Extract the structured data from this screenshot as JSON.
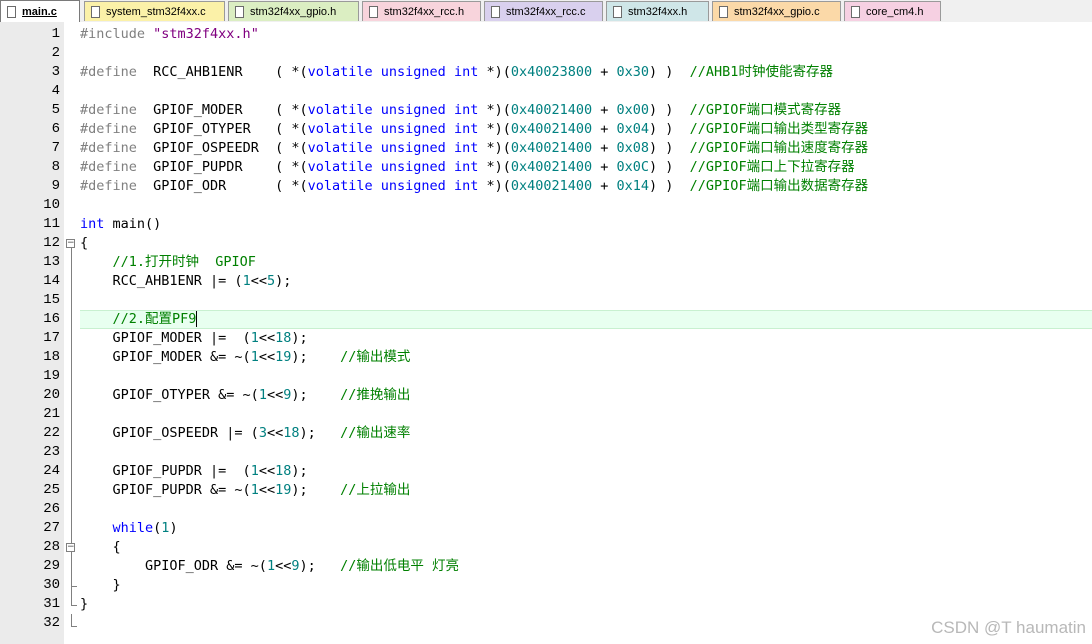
{
  "tabs": [
    {
      "label": "main.c",
      "color": "#ffffff",
      "active": true
    },
    {
      "label": "system_stm32f4xx.c",
      "color": "#fbf1a8",
      "active": false
    },
    {
      "label": "stm32f4xx_gpio.h",
      "color": "#dbeec2",
      "active": false
    },
    {
      "label": "stm32f4xx_rcc.h",
      "color": "#f8d4dc",
      "active": false
    },
    {
      "label": "stm32f4xx_rcc.c",
      "color": "#d9d0ee",
      "active": false
    },
    {
      "label": "stm32f4xx.h",
      "color": "#cfe6e8",
      "active": false
    },
    {
      "label": "stm32f4xx_gpio.c",
      "color": "#fbd9a8",
      "active": false
    },
    {
      "label": "core_cm4.h",
      "color": "#f6d0e2",
      "active": false
    }
  ],
  "editor": {
    "current_line": 16,
    "fold_markers": [
      12,
      28
    ],
    "lines": [
      {
        "n": "1",
        "tokens": [
          [
            "pp",
            "#include "
          ],
          [
            "str",
            "\"stm32f4xx.h\""
          ]
        ]
      },
      {
        "n": "2",
        "tokens": []
      },
      {
        "n": "3",
        "tokens": [
          [
            "pp",
            "#define"
          ],
          [
            "plain",
            "  RCC_AHB1ENR    ( *("
          ],
          [
            "kw",
            "volatile"
          ],
          [
            "plain",
            " "
          ],
          [
            "kw",
            "unsigned"
          ],
          [
            "plain",
            " "
          ],
          [
            "kw",
            "int"
          ],
          [
            "plain",
            " *)("
          ],
          [
            "num",
            "0x40023800"
          ],
          [
            "plain",
            " + "
          ],
          [
            "num",
            "0x30"
          ],
          [
            "plain",
            ") )  "
          ],
          [
            "cmt",
            "//AHB1时钟使能寄存器"
          ]
        ]
      },
      {
        "n": "4",
        "tokens": []
      },
      {
        "n": "5",
        "tokens": [
          [
            "pp",
            "#define"
          ],
          [
            "plain",
            "  GPIOF_MODER    ( *("
          ],
          [
            "kw",
            "volatile"
          ],
          [
            "plain",
            " "
          ],
          [
            "kw",
            "unsigned"
          ],
          [
            "plain",
            " "
          ],
          [
            "kw",
            "int"
          ],
          [
            "plain",
            " *)("
          ],
          [
            "num",
            "0x40021400"
          ],
          [
            "plain",
            " + "
          ],
          [
            "num",
            "0x00"
          ],
          [
            "plain",
            ") )  "
          ],
          [
            "cmt",
            "//GPIOF端口模式寄存器"
          ]
        ]
      },
      {
        "n": "6",
        "tokens": [
          [
            "pp",
            "#define"
          ],
          [
            "plain",
            "  GPIOF_OTYPER   ( *("
          ],
          [
            "kw",
            "volatile"
          ],
          [
            "plain",
            " "
          ],
          [
            "kw",
            "unsigned"
          ],
          [
            "plain",
            " "
          ],
          [
            "kw",
            "int"
          ],
          [
            "plain",
            " *)("
          ],
          [
            "num",
            "0x40021400"
          ],
          [
            "plain",
            " + "
          ],
          [
            "num",
            "0x04"
          ],
          [
            "plain",
            ") )  "
          ],
          [
            "cmt",
            "//GPIOF端口输出类型寄存器"
          ]
        ]
      },
      {
        "n": "7",
        "tokens": [
          [
            "pp",
            "#define"
          ],
          [
            "plain",
            "  GPIOF_OSPEEDR  ( *("
          ],
          [
            "kw",
            "volatile"
          ],
          [
            "plain",
            " "
          ],
          [
            "kw",
            "unsigned"
          ],
          [
            "plain",
            " "
          ],
          [
            "kw",
            "int"
          ],
          [
            "plain",
            " *)("
          ],
          [
            "num",
            "0x40021400"
          ],
          [
            "plain",
            " + "
          ],
          [
            "num",
            "0x08"
          ],
          [
            "plain",
            ") )  "
          ],
          [
            "cmt",
            "//GPIOF端口输出速度寄存器"
          ]
        ]
      },
      {
        "n": "8",
        "tokens": [
          [
            "pp",
            "#define"
          ],
          [
            "plain",
            "  GPIOF_PUPDR    ( *("
          ],
          [
            "kw",
            "volatile"
          ],
          [
            "plain",
            " "
          ],
          [
            "kw",
            "unsigned"
          ],
          [
            "plain",
            " "
          ],
          [
            "kw",
            "int"
          ],
          [
            "plain",
            " *)("
          ],
          [
            "num",
            "0x40021400"
          ],
          [
            "plain",
            " + "
          ],
          [
            "num",
            "0x0C"
          ],
          [
            "plain",
            ") )  "
          ],
          [
            "cmt",
            "//GPIOF端口上下拉寄存器"
          ]
        ]
      },
      {
        "n": "9",
        "tokens": [
          [
            "pp",
            "#define"
          ],
          [
            "plain",
            "  GPIOF_ODR      ( *("
          ],
          [
            "kw",
            "volatile"
          ],
          [
            "plain",
            " "
          ],
          [
            "kw",
            "unsigned"
          ],
          [
            "plain",
            " "
          ],
          [
            "kw",
            "int"
          ],
          [
            "plain",
            " *)("
          ],
          [
            "num",
            "0x40021400"
          ],
          [
            "plain",
            " + "
          ],
          [
            "num",
            "0x14"
          ],
          [
            "plain",
            ") )  "
          ],
          [
            "cmt",
            "//GPIOF端口输出数据寄存器"
          ]
        ]
      },
      {
        "n": "10",
        "tokens": []
      },
      {
        "n": "11",
        "tokens": [
          [
            "kw",
            "int"
          ],
          [
            "plain",
            " main()"
          ]
        ]
      },
      {
        "n": "12",
        "tokens": [
          [
            "plain",
            "{"
          ]
        ]
      },
      {
        "n": "13",
        "tokens": [
          [
            "plain",
            "    "
          ],
          [
            "cmt",
            "//1.打开时钟  GPIOF"
          ]
        ]
      },
      {
        "n": "14",
        "tokens": [
          [
            "plain",
            "    RCC_AHB1ENR |= ("
          ],
          [
            "num",
            "1"
          ],
          [
            "plain",
            "<<"
          ],
          [
            "num",
            "5"
          ],
          [
            "plain",
            ");"
          ]
        ]
      },
      {
        "n": "15",
        "tokens": []
      },
      {
        "n": "16",
        "tokens": [
          [
            "plain",
            "    "
          ],
          [
            "cmt",
            "//2.配置PF9"
          ]
        ]
      },
      {
        "n": "17",
        "tokens": [
          [
            "plain",
            "    GPIOF_MODER |=  ("
          ],
          [
            "num",
            "1"
          ],
          [
            "plain",
            "<<"
          ],
          [
            "num",
            "18"
          ],
          [
            "plain",
            ");"
          ]
        ]
      },
      {
        "n": "18",
        "tokens": [
          [
            "plain",
            "    GPIOF_MODER &= ~("
          ],
          [
            "num",
            "1"
          ],
          [
            "plain",
            "<<"
          ],
          [
            "num",
            "19"
          ],
          [
            "plain",
            ");    "
          ],
          [
            "cmt",
            "//输出模式"
          ]
        ]
      },
      {
        "n": "19",
        "tokens": []
      },
      {
        "n": "20",
        "tokens": [
          [
            "plain",
            "    GPIOF_OTYPER &= ~("
          ],
          [
            "num",
            "1"
          ],
          [
            "plain",
            "<<"
          ],
          [
            "num",
            "9"
          ],
          [
            "plain",
            ");    "
          ],
          [
            "cmt",
            "//推挽输出"
          ]
        ]
      },
      {
        "n": "21",
        "tokens": []
      },
      {
        "n": "22",
        "tokens": [
          [
            "plain",
            "    GPIOF_OSPEEDR |= ("
          ],
          [
            "num",
            "3"
          ],
          [
            "plain",
            "<<"
          ],
          [
            "num",
            "18"
          ],
          [
            "plain",
            ");   "
          ],
          [
            "cmt",
            "//输出速率"
          ]
        ]
      },
      {
        "n": "23",
        "tokens": []
      },
      {
        "n": "24",
        "tokens": [
          [
            "plain",
            "    GPIOF_PUPDR |=  ("
          ],
          [
            "num",
            "1"
          ],
          [
            "plain",
            "<<"
          ],
          [
            "num",
            "18"
          ],
          [
            "plain",
            ");"
          ]
        ]
      },
      {
        "n": "25",
        "tokens": [
          [
            "plain",
            "    GPIOF_PUPDR &= ~("
          ],
          [
            "num",
            "1"
          ],
          [
            "plain",
            "<<"
          ],
          [
            "num",
            "19"
          ],
          [
            "plain",
            ");    "
          ],
          [
            "cmt",
            "//上拉输出"
          ]
        ]
      },
      {
        "n": "26",
        "tokens": []
      },
      {
        "n": "27",
        "tokens": [
          [
            "plain",
            "    "
          ],
          [
            "kw",
            "while"
          ],
          [
            "plain",
            "("
          ],
          [
            "num",
            "1"
          ],
          [
            "plain",
            ")"
          ]
        ]
      },
      {
        "n": "28",
        "tokens": [
          [
            "plain",
            "    {"
          ]
        ]
      },
      {
        "n": "29",
        "tokens": [
          [
            "plain",
            "        GPIOF_ODR &= ~("
          ],
          [
            "num",
            "1"
          ],
          [
            "plain",
            "<<"
          ],
          [
            "num",
            "9"
          ],
          [
            "plain",
            ");   "
          ],
          [
            "cmt",
            "//输出低电平 灯亮"
          ]
        ]
      },
      {
        "n": "30",
        "tokens": [
          [
            "plain",
            "    }"
          ]
        ]
      },
      {
        "n": "31",
        "tokens": [
          [
            "plain",
            "}"
          ]
        ]
      },
      {
        "n": "32",
        "tokens": []
      }
    ]
  },
  "watermark": "CSDN @T haumatin"
}
